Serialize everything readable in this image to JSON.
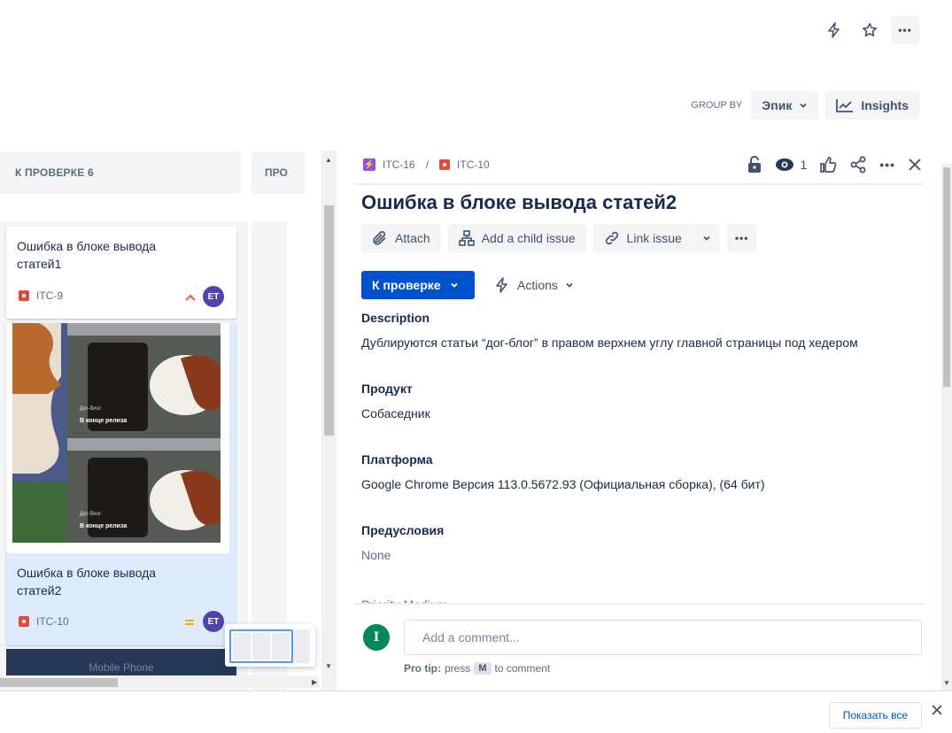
{
  "header": {
    "more_label": "•••"
  },
  "group_by": {
    "label": "GROUP BY",
    "value": "Эпик",
    "insights": "Insights"
  },
  "board": {
    "columns": [
      {
        "title": "К ПРОВЕРКЕ 6"
      },
      {
        "title": "ПРО"
      }
    ],
    "cards": [
      {
        "title": "Ошибка в блоке вывода статей1",
        "key": "ITC-9",
        "priority": "high",
        "assignee": "ET"
      },
      {
        "title": "Ошибка в блоке вывода статей2",
        "key": "ITC-10",
        "priority": "medium",
        "assignee": "ET"
      }
    ],
    "image_captions": [
      {
        "small": "Дог-блог",
        "main": "В конце релиза"
      },
      {
        "small": "Дог-блог",
        "main": "В конце релиза"
      }
    ],
    "mobile_label": "Mobile Phone"
  },
  "issue": {
    "parent_key": "ITC-16",
    "separator": "/",
    "key": "ITC-10",
    "watchers": "1",
    "title": "Ошибка в блоке вывода статей2",
    "buttons": {
      "attach": "Attach",
      "child": "Add a child issue",
      "link": "Link issue"
    },
    "status": "К проверке",
    "actions": "Actions",
    "fields": [
      {
        "label": "Description",
        "value": "Дублируются статьи “дог-блог” в правом верхнем углу главной страницы под хедером"
      },
      {
        "label": "Продукт",
        "value": "Собаседник"
      },
      {
        "label": "Платформа",
        "value": "Google Chrome Версия 113.0.5672.93 (Официальная сборка), (64 бит)"
      },
      {
        "label": "Предусловия",
        "value": "None"
      }
    ],
    "cut_row": "Priority  Medium",
    "comment": {
      "avatar": "I",
      "placeholder": "Add a comment...",
      "tip_bold": "Pro tip:",
      "tip_press": "press",
      "tip_key": "M",
      "tip_rest": "to comment"
    }
  },
  "footer": {
    "show_all": "Показать все"
  },
  "colors": {
    "primary": "#0052cc",
    "bug": "#e5493a",
    "epic": "#904ee2",
    "avatar": "#5243aa",
    "comment_avatar": "#00875a"
  }
}
